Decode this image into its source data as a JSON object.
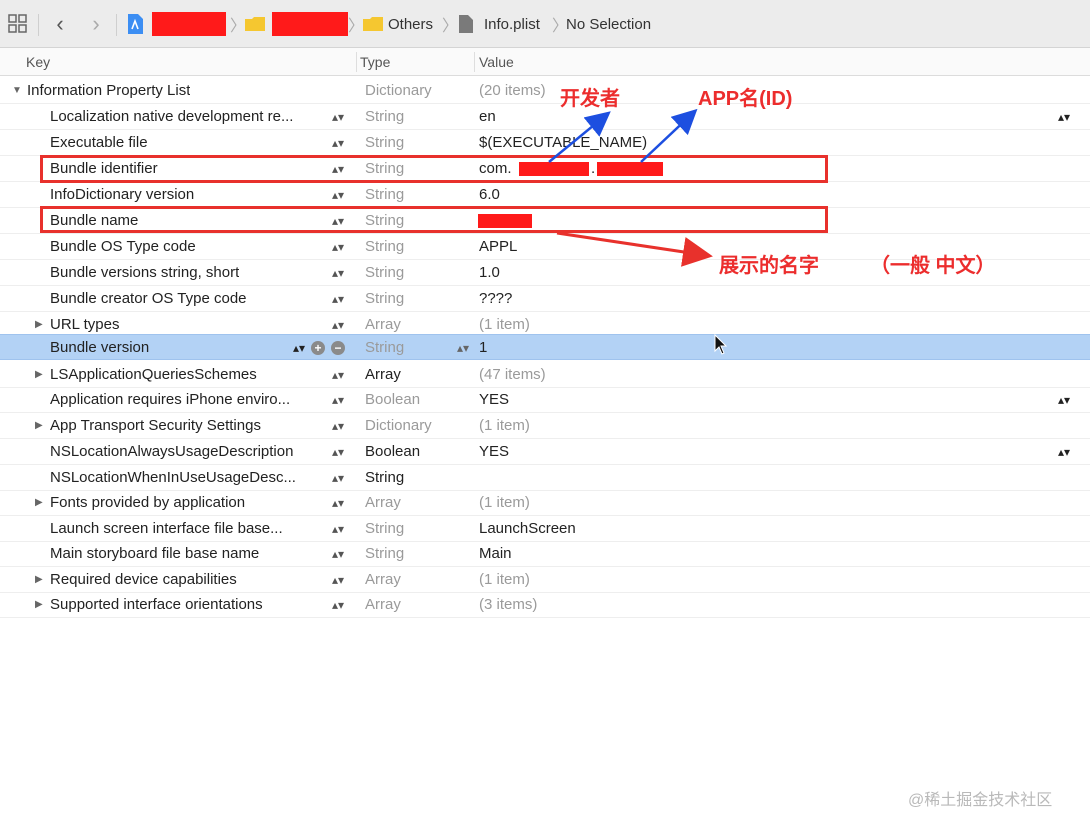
{
  "jumpbar": {
    "crumb_others": "Others",
    "crumb_file": "Info.plist",
    "crumb_selection": "No Selection"
  },
  "columns": {
    "key": "Key",
    "type": "Type",
    "value": "Value"
  },
  "rows": [
    {
      "key": "Information Property List",
      "type": "Dictionary",
      "value": "(20 items)"
    },
    {
      "key": "Localization native development re...",
      "type": "String",
      "value": "en"
    },
    {
      "key": "Executable file",
      "type": "String",
      "value": "$(EXECUTABLE_NAME)"
    },
    {
      "key": "Bundle identifier",
      "type": "String",
      "value": "com."
    },
    {
      "key": "InfoDictionary version",
      "type": "String",
      "value": "6.0"
    },
    {
      "key": "Bundle name",
      "type": "String",
      "value": ""
    },
    {
      "key": "Bundle OS Type code",
      "type": "String",
      "value": "APPL"
    },
    {
      "key": "Bundle versions string, short",
      "type": "String",
      "value": "1.0"
    },
    {
      "key": "Bundle creator OS Type code",
      "type": "String",
      "value": "????"
    },
    {
      "key": "URL types",
      "type": "Array",
      "value": "(1 item)"
    },
    {
      "key": "Bundle version",
      "type": "String",
      "value": "1"
    },
    {
      "key": "LSApplicationQueriesSchemes",
      "type": "Array",
      "value": "(47 items)"
    },
    {
      "key": "Application requires iPhone enviro...",
      "type": "Boolean",
      "value": "YES"
    },
    {
      "key": "App Transport Security Settings",
      "type": "Dictionary",
      "value": "(1 item)"
    },
    {
      "key": "NSLocationAlwaysUsageDescription",
      "type": "Boolean",
      "value": "YES"
    },
    {
      "key": "NSLocationWhenInUseUsageDesc...",
      "type": "String",
      "value": ""
    },
    {
      "key": "Fonts provided by application",
      "type": "Array",
      "value": "(1 item)"
    },
    {
      "key": "Launch screen interface file base...",
      "type": "String",
      "value": "LaunchScreen"
    },
    {
      "key": "Main storyboard file base name",
      "type": "String",
      "value": "Main"
    },
    {
      "key": "Required device capabilities",
      "type": "Array",
      "value": "(1 item)"
    },
    {
      "key": "Supported interface orientations",
      "type": "Array",
      "value": "(3 items)"
    }
  ],
  "annotations": {
    "developer": "开发者",
    "app_name": "APP名(ID)",
    "display_name": "展示的名字",
    "chinese_note": "（一般 中文）"
  },
  "colors": {
    "annotation_red": "#e8312c",
    "arrow_blue": "#1d4fe0",
    "selection": "#b3d2f5"
  },
  "watermark": "@稀土掘金技术社区"
}
